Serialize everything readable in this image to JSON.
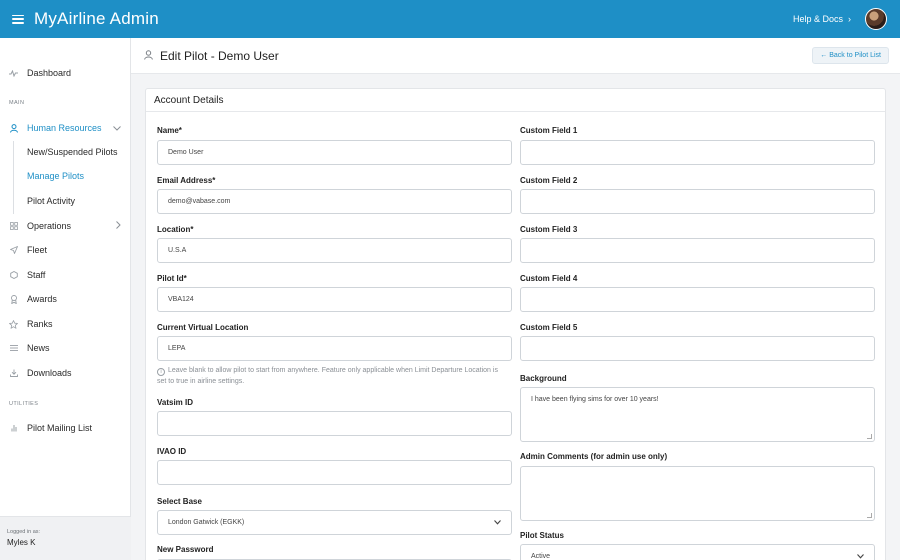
{
  "app": {
    "title": "MyAirline Admin",
    "help_label": "Help & Docs",
    "help_chevron": "›"
  },
  "sidebar": {
    "dashboard": "Dashboard",
    "main_label": "MAIN",
    "hr": "Human Resources",
    "hr_sub": [
      "New/Suspended Pilots",
      "Manage Pilots",
      "Pilot Activity"
    ],
    "operations": "Operations",
    "fleet": "Fleet",
    "staff": "Staff",
    "awards": "Awards",
    "ranks": "Ranks",
    "news": "News",
    "downloads": "Downloads",
    "utilities_label": "UTILITIES",
    "mailing": "Pilot Mailing List",
    "logged_in_label": "Logged in as:",
    "logged_in_user": "Myles K"
  },
  "page": {
    "title": "Edit Pilot - Demo User",
    "back_label": "← Back to Pilot List"
  },
  "card": {
    "title": "Account Details"
  },
  "form": {
    "name_label": "Name*",
    "name_value": "Demo User",
    "email_label": "Email Address*",
    "email_value": "demo@vabase.com",
    "location_label": "Location*",
    "location_value": "U.S.A",
    "pilotid_label": "Pilot Id*",
    "pilotid_value": "VBA124",
    "cvl_label": "Current Virtual Location",
    "cvl_value": "LEPA",
    "cvl_help": "Leave blank to allow pilot to start from anywhere. Feature only applicable when Limit Departure Location is set to true in airline settings.",
    "vatsim_label": "Vatsim ID",
    "vatsim_value": "",
    "ivao_label": "IVAO ID",
    "ivao_value": "",
    "base_label": "Select Base",
    "base_value": "London Gatwick (EGKK)",
    "newpw_label": "New Password",
    "cf1_label": "Custom Field 1",
    "cf2_label": "Custom Field 2",
    "cf3_label": "Custom Field 3",
    "cf4_label": "Custom Field 4",
    "cf5_label": "Custom Field 5",
    "background_label": "Background",
    "background_value": "I have been flying sims for over 10 years!",
    "admin_comments_label": "Admin Comments (for admin use only)",
    "admin_comments_value": "",
    "status_label": "Pilot Status",
    "status_value": "Active"
  }
}
